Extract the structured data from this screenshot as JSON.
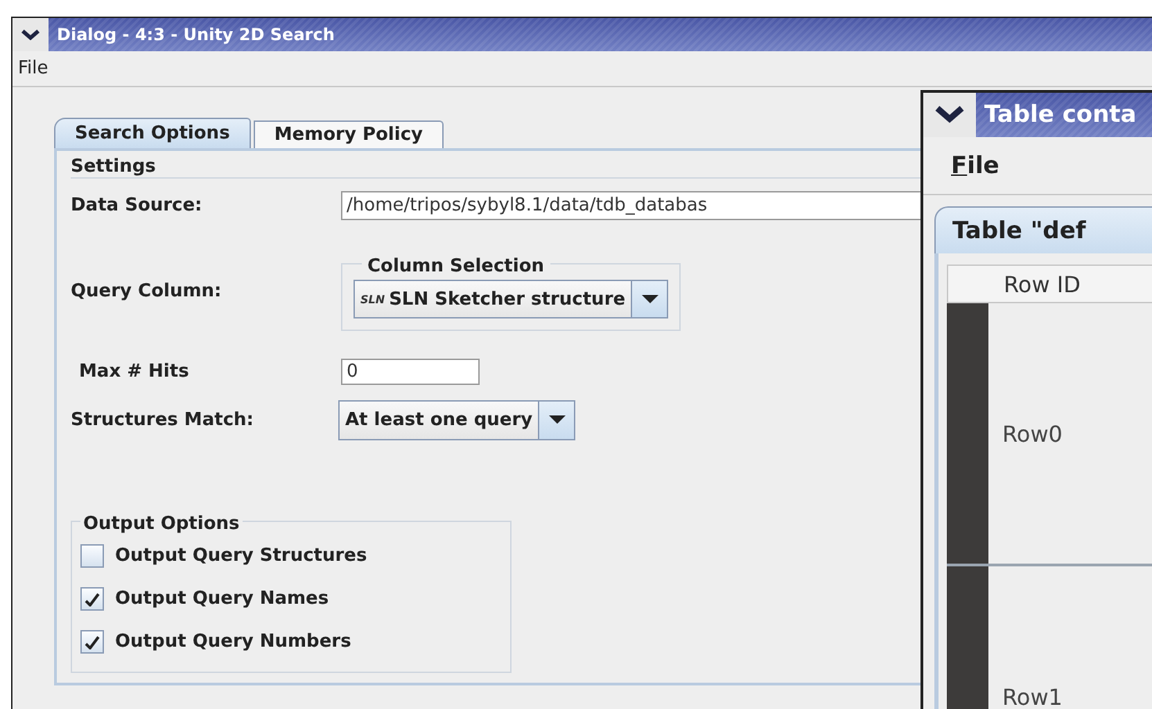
{
  "dialog": {
    "title": "Dialog - 4:3 - Unity 2D Search",
    "menu": [
      "File"
    ],
    "tabs": [
      {
        "label": "Search Options",
        "selected": true
      },
      {
        "label": "Memory Policy",
        "selected": false
      }
    ],
    "settings": {
      "title": "Settings",
      "data_source": {
        "label": "Data Source:",
        "value": "/home/tripos/sybyl8.1/data/tdb_databas"
      },
      "query_column": {
        "label": "Query Column:",
        "group_title": "Column Selection",
        "badge": "SLN",
        "value": "SLN Sketcher structure"
      },
      "max_hits": {
        "label": "Max # Hits",
        "value": "0"
      },
      "structures_match": {
        "label": "Structures Match:",
        "value": "At least one query"
      }
    },
    "output_options": {
      "title": "Output Options",
      "items": [
        {
          "label": "Output Query Structures",
          "checked": false
        },
        {
          "label": "Output Query Names",
          "checked": true
        },
        {
          "label": "Output Query Numbers",
          "checked": true
        }
      ]
    }
  },
  "table_window": {
    "title": "Table conta",
    "menu": [
      "File"
    ],
    "tabs": [
      {
        "label": "Table \"def",
        "selected": true
      }
    ],
    "columns": [
      "Row ID"
    ],
    "rows": [
      "Row0",
      "Row1"
    ]
  }
}
